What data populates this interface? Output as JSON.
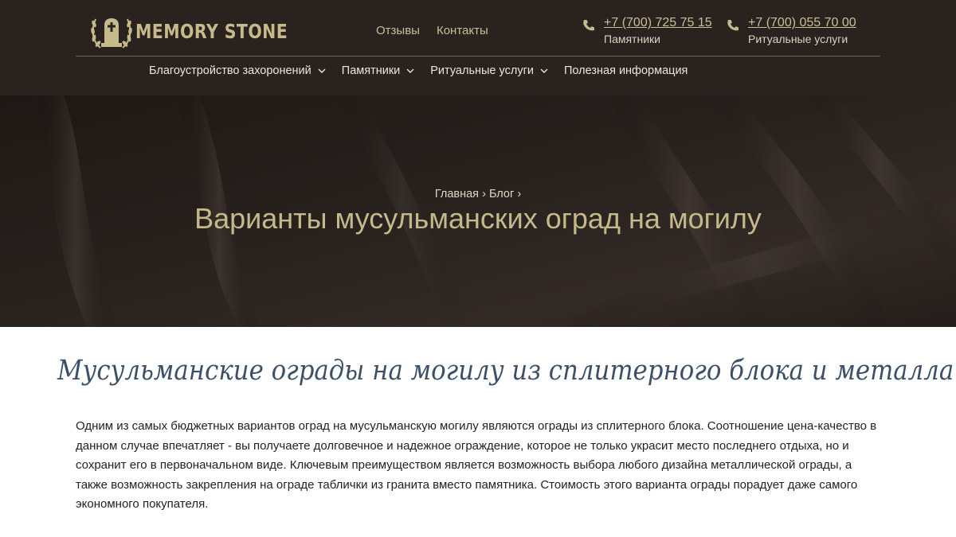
{
  "header": {
    "logo_text": "MEMORY STONE",
    "top_links": [
      "Отзывы",
      "Контакты"
    ],
    "phones": [
      {
        "number": "+7 (700) 725 75 15",
        "label": "Памятники"
      },
      {
        "number": "+7 (700) 055 70 00",
        "label": "Ритуальные услуги"
      }
    ],
    "nav": [
      {
        "label": "Благоустройство захоронений",
        "has_dropdown": true
      },
      {
        "label": "Памятники",
        "has_dropdown": true
      },
      {
        "label": "Ритуальные услуги",
        "has_dropdown": true
      },
      {
        "label": "Полезная информация",
        "has_dropdown": false
      }
    ]
  },
  "hero": {
    "breadcrumb": [
      "Главная",
      "Блог"
    ],
    "title": "Варианты мусульманских оград на могилу"
  },
  "content": {
    "heading": "Мусульманские ограды на могилу из сплитерного блока и металла",
    "paragraph": "Одним из самых бюджетных вариантов оград на мусульманскую могилу являются ограды из сплитерного блока. Соотношение цена-качество в данном случае впечатляет - вы получаете долговечное и надежное ограждение, которое не только украсит место последнего отдыха, но и сохранит его в первоначальном виде. Ключевым преимуществом является возможность выбора любого дизайна металлической ограды, а также возможность закрепления на ограде таблички из гранита вместо памятника. Стоимость этого варианта ограды порадует даже самого экономного покупателя."
  },
  "colors": {
    "header_bg": "#2a221f",
    "accent_gold": "#c9bf95",
    "heading_blue": "#3d5068"
  },
  "icons": {
    "logo": "laurel-tombstone-icon",
    "phone": "phone-icon",
    "dropdown": "chevron-down-icon"
  }
}
